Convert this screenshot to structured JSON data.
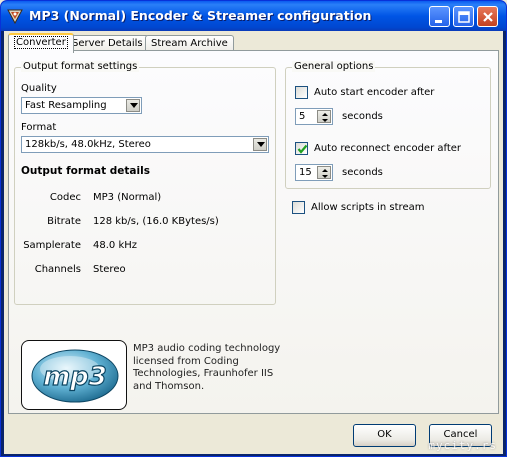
{
  "window": {
    "title": "MP3 (Normal) Encoder & Streamer configuration",
    "icon": "app-icon"
  },
  "tabs": [
    {
      "label": "Converter",
      "active": true
    },
    {
      "label": "Server Details",
      "active": false
    },
    {
      "label": "Stream Archive",
      "active": false
    }
  ],
  "output_format": {
    "group_title": "Output format settings",
    "quality_label": "Quality",
    "quality_value": "Fast Resampling",
    "format_label": "Format",
    "format_value": "128kb/s, 48.0kHz, Stereo",
    "details_title": "Output format details",
    "details": [
      {
        "key": "Codec",
        "value": "MP3 (Normal)"
      },
      {
        "key": "Bitrate",
        "value": "128 kb/s, (16.0 KBytes/s)"
      },
      {
        "key": "Samplerate",
        "value": "48.0 kHz"
      },
      {
        "key": "Channels",
        "value": "Stereo"
      }
    ]
  },
  "general_options": {
    "group_title": "General options",
    "auto_start_label": "Auto start encoder after",
    "auto_start_checked": false,
    "auto_start_value": "5",
    "auto_start_unit": "seconds",
    "auto_reconnect_label": "Auto reconnect encoder after",
    "auto_reconnect_checked": true,
    "auto_reconnect_value": "15",
    "auto_reconnect_unit": "seconds"
  },
  "allow_scripts": {
    "label": "Allow scripts in stream",
    "checked": false
  },
  "logo": {
    "text": "mp3"
  },
  "license_text": "MP3 audio coding technology licensed from Coding Technologies, Fraunhofer IIS and Thomson.",
  "buttons": {
    "ok": "OK",
    "cancel": "Cancel"
  },
  "watermark": "mycity.rs",
  "colors": {
    "titlebar": "#0055e5",
    "accent_tab": "#ffc83c",
    "close_button": "#c3411f"
  }
}
